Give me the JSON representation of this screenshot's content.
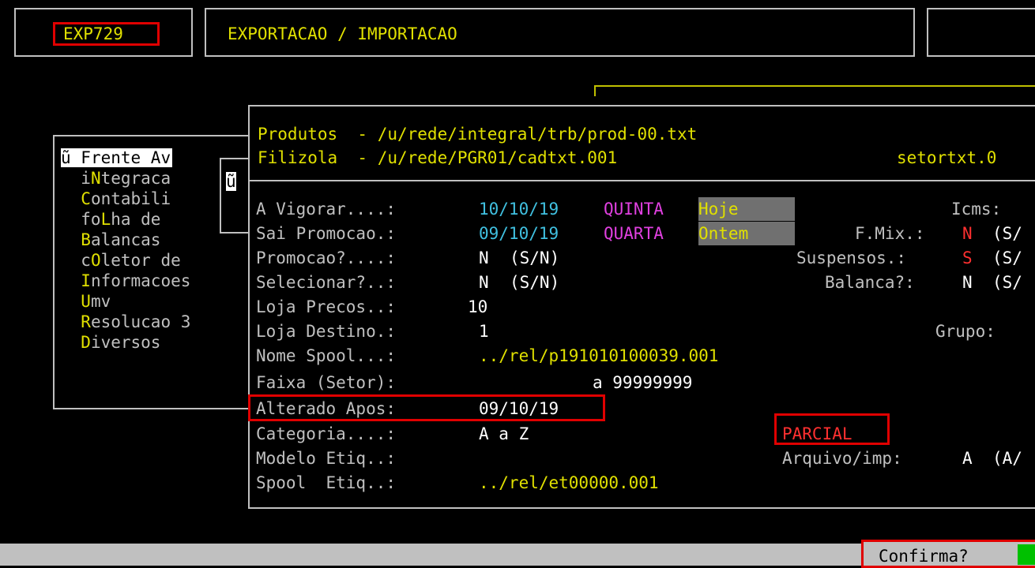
{
  "header": {
    "program_code": "EXP729",
    "title": "EXPORTACAO / IMPORTACAO"
  },
  "menu": {
    "items": [
      {
        "prefix": "ũ ",
        "hot": "F",
        "rest": "rente Av"
      },
      {
        "prefix": "  i",
        "hot": "N",
        "rest": "tegraca"
      },
      {
        "prefix": "  ",
        "hot": "C",
        "rest": "ontabili"
      },
      {
        "prefix": "  fo",
        "hot": "L",
        "rest": "ha de"
      },
      {
        "prefix": "  ",
        "hot": "B",
        "rest": "alancas"
      },
      {
        "prefix": "  c",
        "hot": "O",
        "rest": "letor de"
      },
      {
        "prefix": "  ",
        "hot": "I",
        "rest": "nformacoes"
      },
      {
        "prefix": "  ",
        "hot": "U",
        "rest": "mv"
      },
      {
        "prefix": "  ",
        "hot": "R",
        "rest": "esolucao 3"
      },
      {
        "prefix": "  ",
        "hot": "D",
        "rest": "iversos"
      }
    ],
    "submenu_glyph": "ũ"
  },
  "files": {
    "produtos_label": "Produtos  - ",
    "produtos_path": "/u/rede/integral/trb/prod-00.txt",
    "filizola_label": "Filizola  - ",
    "filizola_path": "/u/rede/PGR01/cadtxt.001",
    "setor_file": "setortxt.0"
  },
  "form": {
    "a_vigorar": {
      "label": "A Vigorar....:",
      "date": "10/10/19",
      "weekday": "QUINTA",
      "tag": "Hoje"
    },
    "sai_promocao": {
      "label": "Sai Promocao.:",
      "date": "09/10/19",
      "weekday": "QUARTA",
      "tag": "Ontem"
    },
    "promocao": {
      "label": "Promocao?....:",
      "value": "N",
      "hint": "(S/N)"
    },
    "selecionar": {
      "label": "Selecionar?..:",
      "value": "N",
      "hint": "(S/N)"
    },
    "loja_precos": {
      "label": "Loja Precos..:",
      "value": "10"
    },
    "loja_destino": {
      "label": "Loja Destino.:",
      "value": "1"
    },
    "nome_spool": {
      "label": "Nome Spool...:",
      "value": "../rel/p191010100039.001"
    },
    "faixa_setor": {
      "label": "Faixa (Setor):",
      "value": "a 99999999"
    },
    "alterado_apos": {
      "label": "Alterado Apos:",
      "value": "09/10/19"
    },
    "categoria": {
      "label": "Categoria....:",
      "value": "A a Z"
    },
    "modelo_etiq": {
      "label": "Modelo Etiq..:"
    },
    "spool_etiq": {
      "label": "Spool  Etiq..:",
      "value": "../rel/et00000.001"
    }
  },
  "right_column": {
    "icms_label": "Icms:",
    "fmix_label": "F.Mix.:",
    "fmix_value": "N",
    "fmix_hint": "(S/",
    "suspensos_label": "Suspensos.:",
    "suspensos_value": "S",
    "suspensos_hint": "(S/",
    "balanca_label": "Balanca?:",
    "balanca_value": "N",
    "balanca_hint": "(S/",
    "grupo_label": "Grupo:",
    "parcial": "PARCIAL",
    "arquivo_label": "Arquivo/imp:",
    "arquivo_value": "A",
    "arquivo_hint": "(A/"
  },
  "status": {
    "confirm_label": "Confirma?"
  }
}
